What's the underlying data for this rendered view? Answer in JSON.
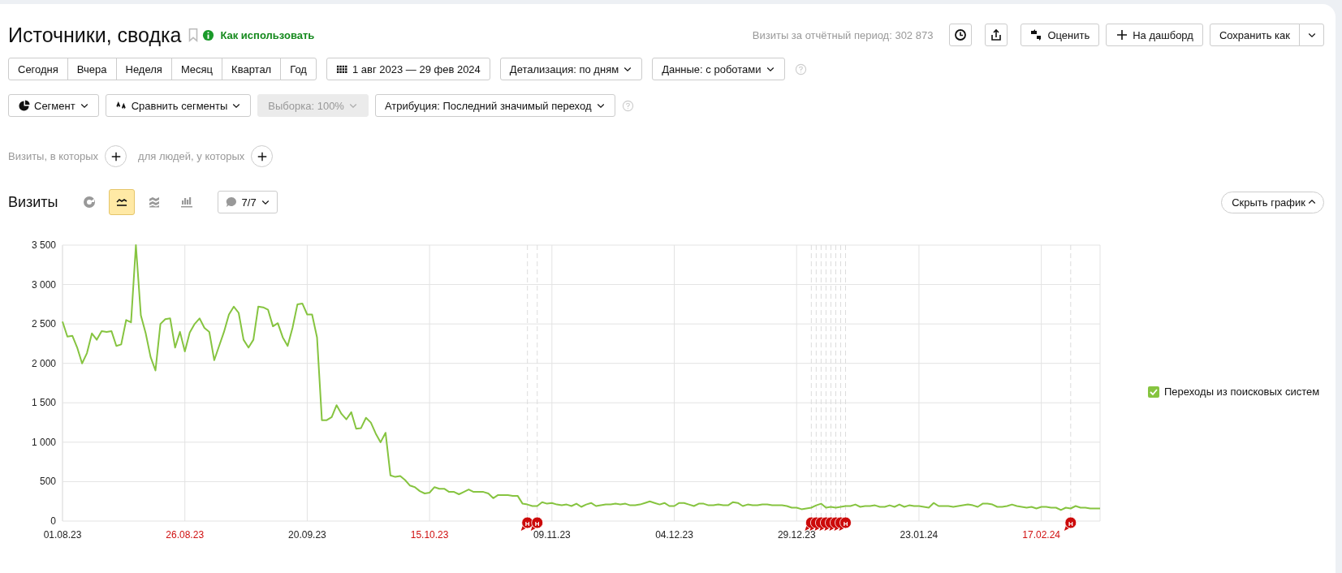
{
  "header": {
    "title": "Источники, сводка",
    "help_link": "Как использовать",
    "total": "Визиты за отчётный период: 302 873",
    "actions": [
      {
        "kind": "clock"
      },
      {
        "kind": "share"
      },
      {
        "kind": "rate",
        "label": "Оценить"
      },
      {
        "kind": "add",
        "label": "На дашборд"
      }
    ],
    "save": "Сохранить как"
  },
  "periods": [
    "Сегодня",
    "Вчера",
    "Неделя",
    "Месяц",
    "Квартал",
    "Год"
  ],
  "date_range": "1 авг 2023 — 29 фев 2024",
  "filters": [
    {
      "label": "Детализация: по дням"
    },
    {
      "label": "Данные: с роботами",
      "help": true
    }
  ],
  "segment_bar": [
    {
      "kind": "segment",
      "label": "Сегмент",
      "disabled": false
    },
    {
      "kind": "compare",
      "label": "Сравнить сегменты",
      "disabled": false
    },
    {
      "kind": "sample",
      "label": "Выборка: 100%",
      "disabled": true
    },
    {
      "kind": "attribution",
      "label": "Атрибуция: Последний значимый переход",
      "disabled": false,
      "help": true
    }
  ],
  "conditions": [
    "Визиты, в которых",
    "для людей, у которых"
  ],
  "chart_section": {
    "title": "Визиты",
    "chart_types": [
      {
        "kind": "pie",
        "selected": false
      },
      {
        "kind": "line",
        "selected": true
      },
      {
        "kind": "area",
        "selected": false
      },
      {
        "kind": "bars",
        "selected": false
      }
    ],
    "notes": "7/7",
    "hide_button": "Скрыть график",
    "tick_styles": [
      {
        "weekend": false
      },
      {
        "weekend": true
      },
      {
        "weekend": false
      },
      {
        "weekend": true
      },
      {
        "weekend": false
      },
      {
        "weekend": false
      },
      {
        "weekend": false
      },
      {
        "weekend": false
      },
      {
        "weekend": true
      }
    ],
    "chart_data": {
      "type": "line",
      "grid": true,
      "ylim": [
        0,
        3500
      ],
      "categories": [
        "01.08.23",
        null,
        null,
        null,
        null,
        null,
        null,
        null,
        null,
        null,
        null,
        null,
        null,
        null,
        null,
        null,
        null,
        null,
        null,
        null,
        null,
        null,
        null,
        null,
        null,
        "26.08.23",
        null,
        null,
        null,
        null,
        null,
        null,
        null,
        null,
        null,
        null,
        null,
        null,
        null,
        null,
        null,
        null,
        null,
        null,
        null,
        null,
        null,
        null,
        null,
        null,
        "20.09.23",
        null,
        null,
        null,
        null,
        null,
        null,
        null,
        null,
        null,
        null,
        null,
        null,
        null,
        null,
        null,
        null,
        null,
        null,
        null,
        null,
        null,
        null,
        null,
        null,
        "15.10.23",
        null,
        null,
        null,
        null,
        null,
        null,
        null,
        null,
        null,
        null,
        null,
        null,
        null,
        null,
        null,
        null,
        null,
        null,
        null,
        null,
        null,
        null,
        null,
        null,
        "09.11.23",
        null,
        null,
        null,
        null,
        null,
        null,
        null,
        null,
        null,
        null,
        null,
        null,
        null,
        null,
        null,
        null,
        null,
        null,
        null,
        null,
        null,
        null,
        null,
        null,
        "04.12.23",
        null,
        null,
        null,
        null,
        null,
        null,
        null,
        null,
        null,
        null,
        null,
        null,
        null,
        null,
        null,
        null,
        null,
        null,
        null,
        null,
        null,
        null,
        null,
        null,
        "29.12.23",
        null,
        null,
        null,
        null,
        null,
        null,
        null,
        null,
        null,
        null,
        null,
        null,
        null,
        null,
        null,
        null,
        null,
        null,
        null,
        null,
        null,
        null,
        null,
        null,
        "23.01.24",
        null,
        null,
        null,
        null,
        null,
        null,
        null,
        null,
        null,
        null,
        null,
        null,
        null,
        null,
        null,
        null,
        null,
        null,
        null,
        null,
        null,
        null,
        null,
        null,
        "17.02.24",
        null,
        null,
        null,
        null,
        null,
        null,
        null,
        null,
        null,
        null,
        null,
        null
      ],
      "yticks": [
        {
          "value": 0,
          "label": "0"
        },
        {
          "value": 500,
          "label": "500"
        },
        {
          "value": 1000,
          "label": "1 000"
        },
        {
          "value": 1500,
          "label": "1 500"
        },
        {
          "value": 2000,
          "label": "2 000"
        },
        {
          "value": 2500,
          "label": "2 500"
        },
        {
          "value": 3000,
          "label": "3 000"
        },
        {
          "value": 3500,
          "label": "3 500"
        }
      ],
      "series": [
        {
          "name": "Переходы из поисковых систем",
          "color": "#86c440",
          "values": [
            2530,
            2340,
            2350,
            2200,
            2000,
            2130,
            2380,
            2300,
            2410,
            2400,
            2410,
            2220,
            2240,
            2550,
            2520,
            3500,
            2610,
            2380,
            2080,
            1910,
            2500,
            2560,
            2570,
            2200,
            2400,
            2150,
            2390,
            2500,
            2570,
            2450,
            2400,
            2040,
            2220,
            2400,
            2620,
            2720,
            2640,
            2300,
            2200,
            2300,
            2720,
            2710,
            2680,
            2470,
            2510,
            2330,
            2220,
            2450,
            2750,
            2760,
            2620,
            2620,
            2330,
            1280,
            1280,
            1320,
            1470,
            1360,
            1290,
            1380,
            1170,
            1180,
            1310,
            1250,
            1110,
            1000,
            1120,
            580,
            560,
            570,
            520,
            450,
            430,
            380,
            350,
            360,
            430,
            410,
            410,
            370,
            370,
            340,
            370,
            400,
            370,
            370,
            370,
            350,
            290,
            330,
            330,
            330,
            320,
            320,
            220,
            210,
            190,
            190,
            240,
            220,
            230,
            210,
            200,
            210,
            190,
            220,
            180,
            210,
            230,
            190,
            200,
            210,
            210,
            220,
            210,
            220,
            200,
            200,
            210,
            230,
            250,
            230,
            210,
            230,
            190,
            190,
            230,
            230,
            210,
            190,
            220,
            220,
            200,
            200,
            210,
            200,
            200,
            240,
            230,
            190,
            210,
            200,
            200,
            210,
            210,
            200,
            200,
            200,
            190,
            170,
            170,
            150,
            160,
            170,
            200,
            220,
            170,
            180,
            170,
            180,
            190,
            190,
            210,
            180,
            190,
            190,
            200,
            180,
            180,
            200,
            180,
            210,
            180,
            200,
            190,
            190,
            180,
            170,
            230,
            190,
            190,
            190,
            180,
            190,
            200,
            210,
            200,
            180,
            220,
            220,
            210,
            180,
            180,
            190,
            210,
            190,
            180,
            170,
            180,
            160,
            180,
            180,
            170,
            170,
            140,
            170,
            160,
            190,
            170,
            170,
            160,
            160,
            160
          ]
        }
      ],
      "xlabel": null
    },
    "note_markers": [
      {
        "text": "Н",
        "covered": false
      },
      {
        "text": "Н",
        "covered": false
      },
      {
        "covered": true
      },
      {
        "covered": true
      },
      {
        "covered": true
      },
      {
        "covered": true
      },
      {
        "covered": true
      },
      {
        "covered": true
      },
      {
        "covered": true
      },
      {
        "text": "Н",
        "covered": false
      },
      {
        "text": "Н",
        "covered": false
      }
    ]
  }
}
